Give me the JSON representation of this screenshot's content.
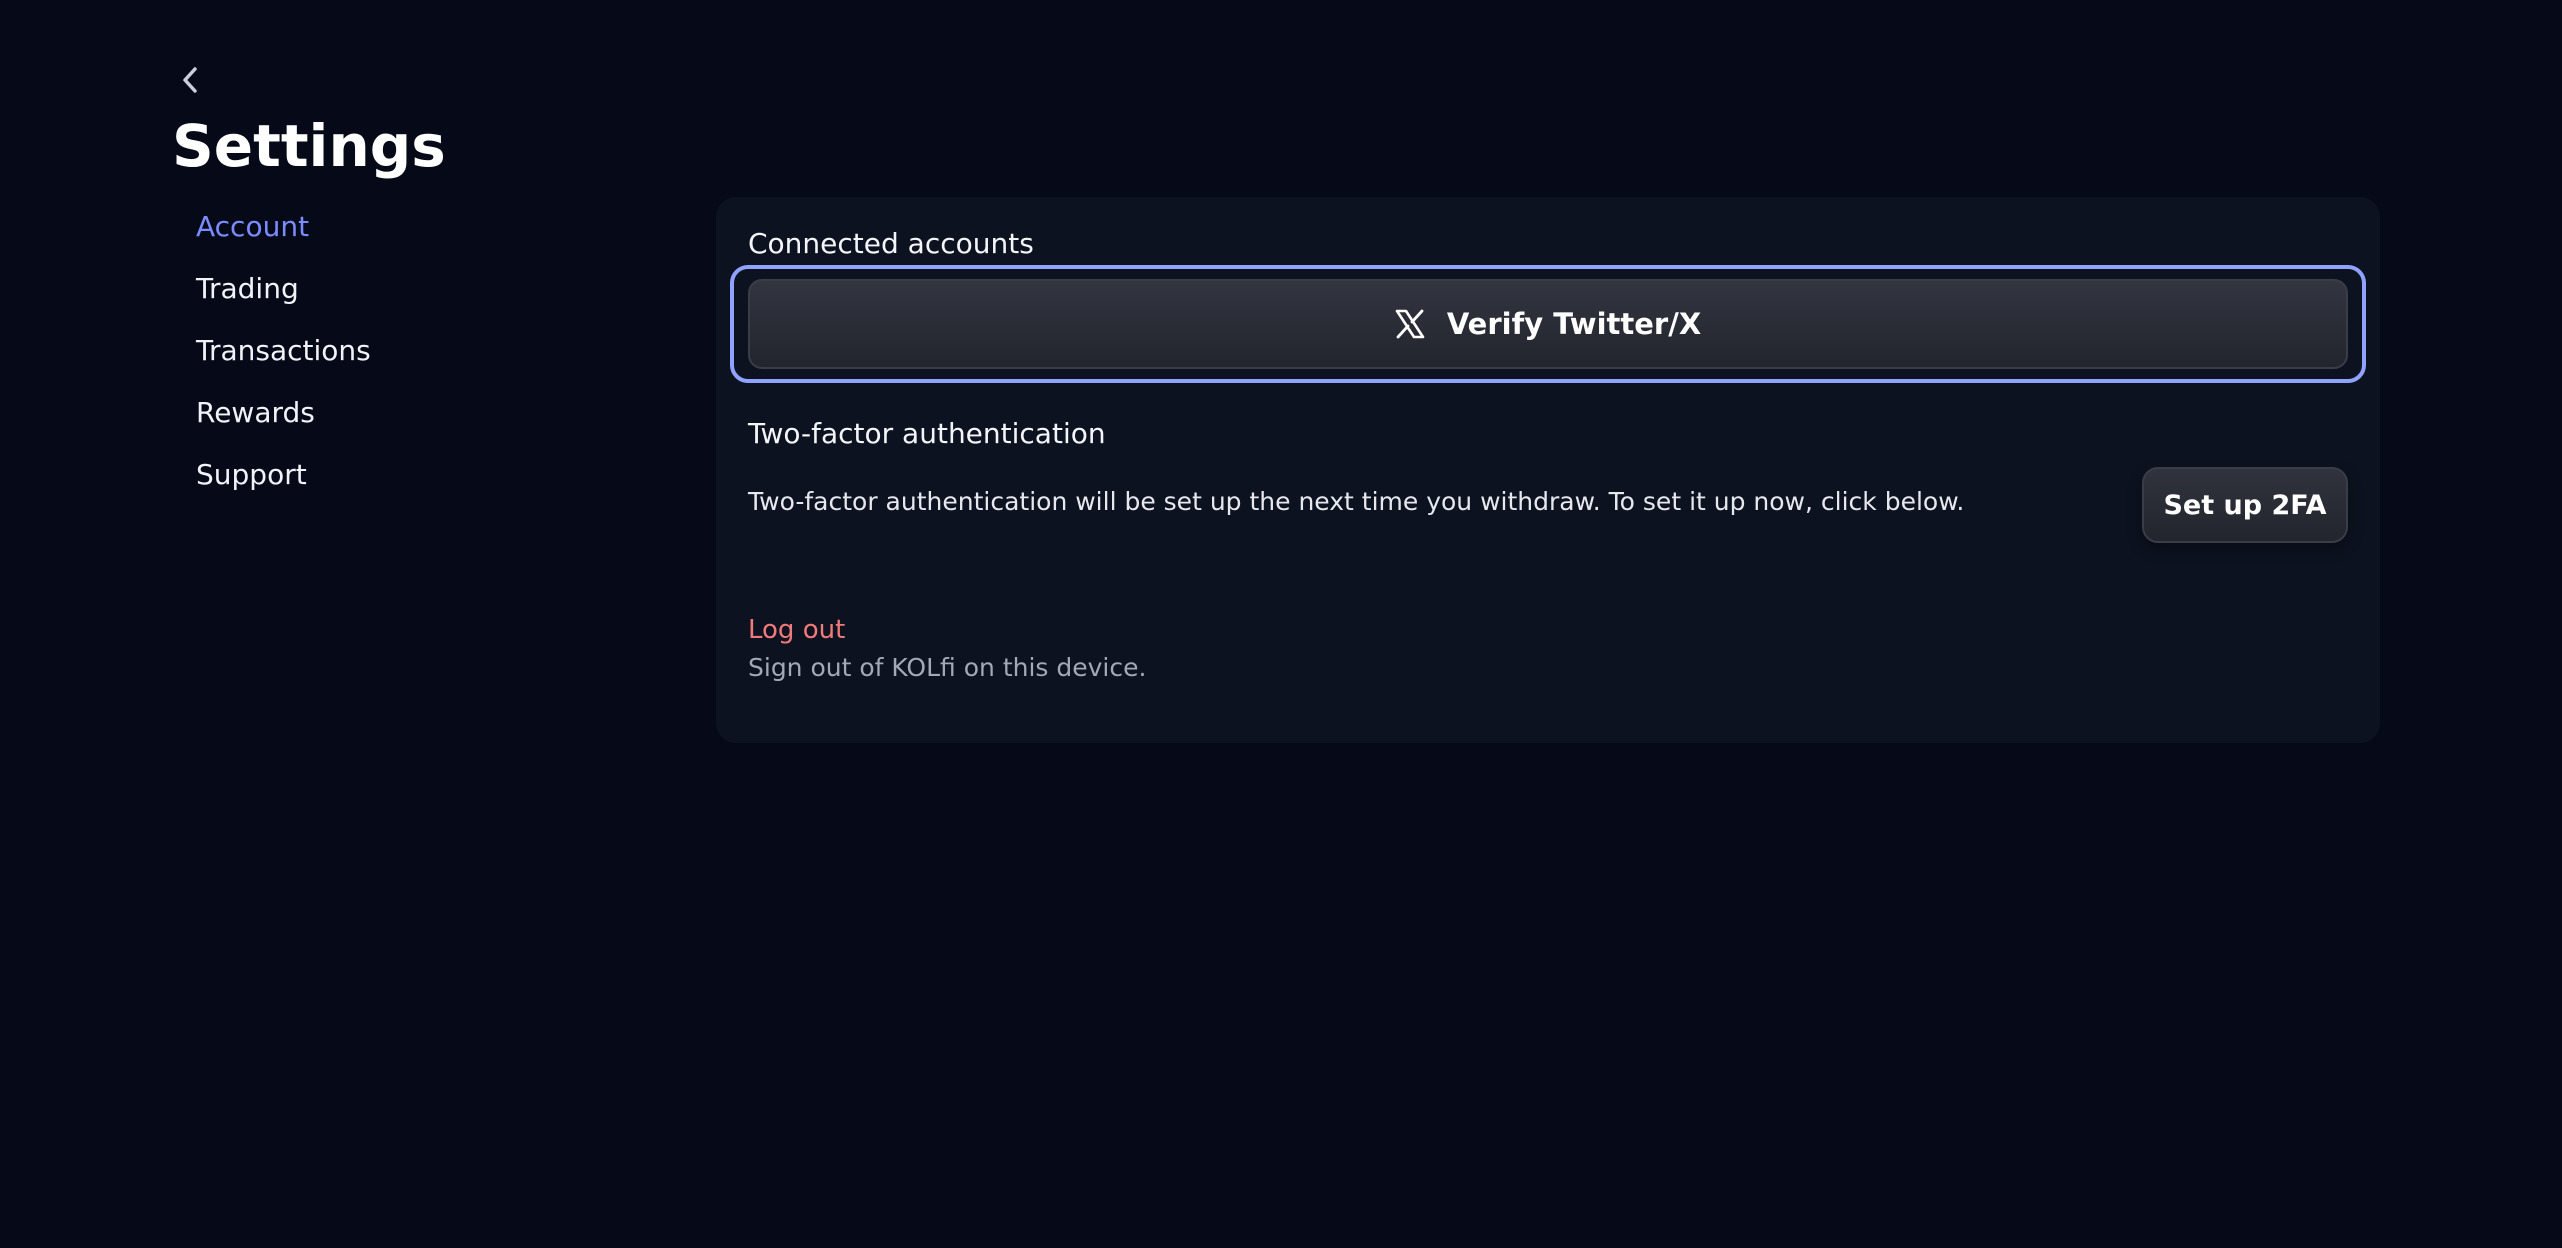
{
  "header": {
    "back_icon": "chevron-left-icon",
    "title": "Settings"
  },
  "sidebar": {
    "items": [
      {
        "label": "Account",
        "active": true
      },
      {
        "label": "Trading",
        "active": false
      },
      {
        "label": "Transactions",
        "active": false
      },
      {
        "label": "Rewards",
        "active": false
      },
      {
        "label": "Support",
        "active": false
      }
    ]
  },
  "main": {
    "connected_accounts": {
      "title": "Connected accounts",
      "verify_button": {
        "icon": "x-logo-icon",
        "label": "Verify Twitter/X"
      }
    },
    "two_factor": {
      "title": "Two-factor authentication",
      "description": "Two-factor authentication will be set up the next time you withdraw. To set it up now, click below.",
      "button_label": "Set up 2FA"
    },
    "logout": {
      "label": "Log out",
      "description": "Sign out of KOLfi on this device."
    }
  },
  "colors": {
    "background": "#060a18",
    "card": "#0d1220",
    "accent": "#7a8cff",
    "focus_ring": "#8fa2ff",
    "danger": "#f07a7a"
  }
}
